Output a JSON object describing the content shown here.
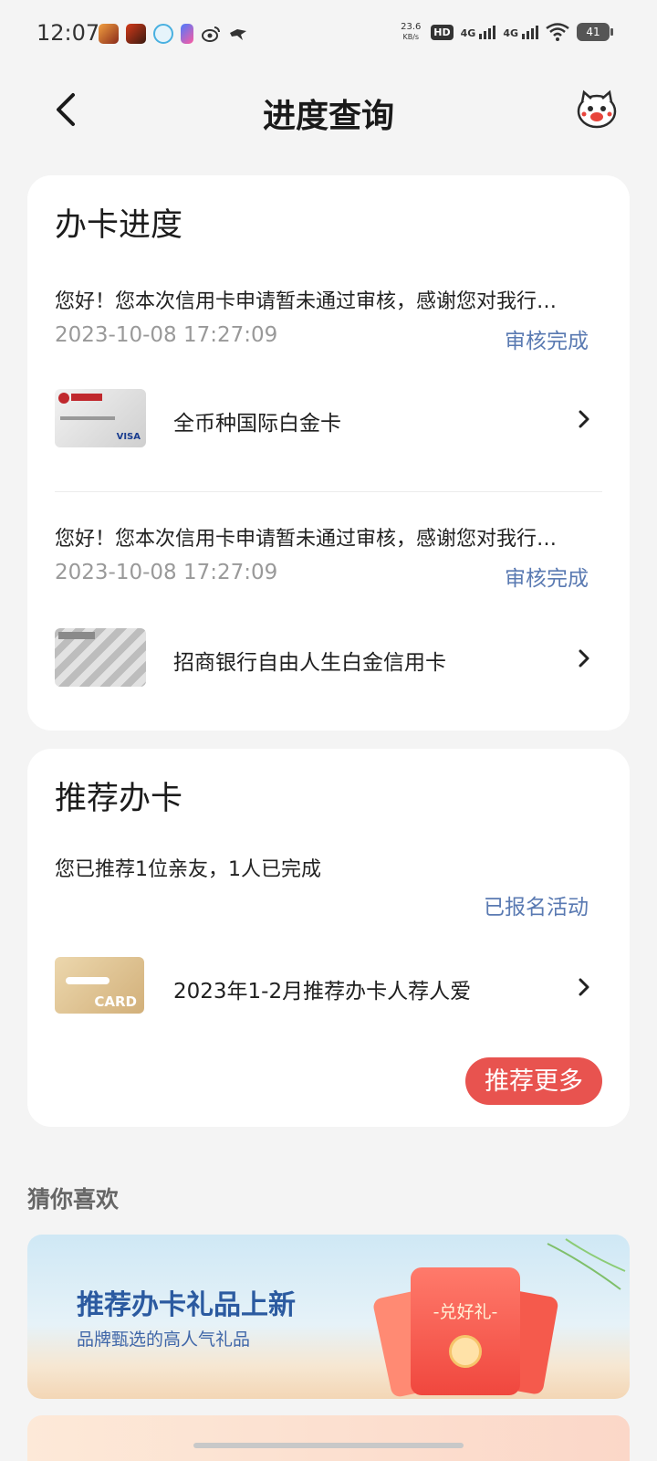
{
  "status_bar": {
    "time": "12:07",
    "net_speed_value": "23.6",
    "net_speed_unit": "KB/s",
    "hd_label": "HD",
    "signal1": "4G",
    "signal2": "4G",
    "battery": "41"
  },
  "nav": {
    "title": "进度查询"
  },
  "progress": {
    "title": "办卡进度",
    "items": [
      {
        "message": "您好！您本次信用卡申请暂未通过审核，感谢您对我行…",
        "datetime": "2023-10-08 17:27:09",
        "status": "审核完成",
        "card_name": "全币种国际白金卡"
      },
      {
        "message": "您好！您本次信用卡申请暂未通过审核，感谢您对我行…",
        "datetime": "2023-10-08 17:27:09",
        "status": "审核完成",
        "card_name": "招商银行自由人生白金信用卡"
      }
    ]
  },
  "recommend": {
    "title": "推荐办卡",
    "summary": "您已推荐1位亲友，1人已完成",
    "status": "已报名活动",
    "activity_name": "2023年1-2月推荐办卡人荐人爱",
    "card_icon_text": "CARD",
    "more_button": "推荐更多"
  },
  "guess": {
    "title": "猜你喜欢",
    "banner_title": "推荐办卡礼品上新",
    "banner_subtitle": "品牌甄选的高人气礼品",
    "banner_badge": "-兑好礼-"
  },
  "colors": {
    "accent_red": "#e8534f",
    "status_blue": "#5a7ab2"
  }
}
